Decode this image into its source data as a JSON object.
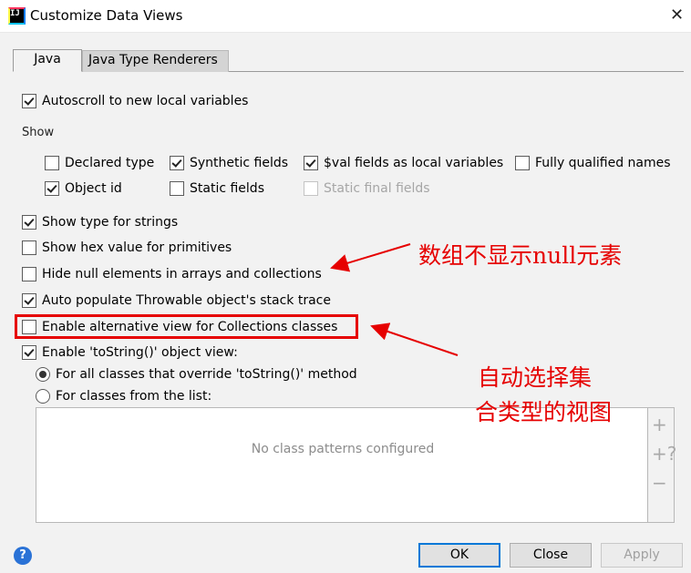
{
  "window": {
    "title": "Customize Data Views",
    "app_icon_text": "IJ"
  },
  "tabs": [
    {
      "label": "Java"
    },
    {
      "label": "Java Type Renderers"
    }
  ],
  "autoscroll": {
    "label": "Autoscroll to new local variables",
    "checked": true
  },
  "show_section": {
    "label": "Show",
    "row1": [
      {
        "label": "Declared type",
        "checked": false
      },
      {
        "label": "Synthetic fields",
        "checked": true
      },
      {
        "label": "$val fields as local variables",
        "checked": true
      },
      {
        "label": "Fully qualified names",
        "checked": false
      }
    ],
    "row2": [
      {
        "label": "Object id",
        "checked": true
      },
      {
        "label": "Static fields",
        "checked": false
      },
      {
        "label": "Static final fields",
        "checked": false,
        "disabled": true
      }
    ]
  },
  "options": [
    {
      "label": "Show type for strings",
      "checked": true
    },
    {
      "label": "Show hex value for primitives",
      "checked": false
    },
    {
      "label": "Hide null elements in arrays and collections",
      "checked": false
    },
    {
      "label": "Auto populate Throwable object's stack trace",
      "checked": true
    },
    {
      "label": "Enable alternative view for Collections classes",
      "checked": false
    },
    {
      "label": "Enable 'toString()' object view:",
      "checked": true
    }
  ],
  "tostring_radios": [
    {
      "label": "For all classes that override 'toString()' method",
      "selected": true
    },
    {
      "label": "For classes from the list:",
      "selected": false
    }
  ],
  "class_list": {
    "empty_text": "No class patterns configured"
  },
  "side_tools": {
    "add": "+",
    "add_query": "+?",
    "remove": "−"
  },
  "annotations": {
    "null_note": "数组不显示null元素",
    "collections_note_line1": "自动选择集",
    "collections_note_line2": "合类型的视图"
  },
  "buttons": {
    "help": "?",
    "ok": "OK",
    "close": "Close",
    "apply": "Apply"
  },
  "colors": {
    "annotation": "#e60000",
    "ok_border": "#0078d7",
    "help": "#2a72d6"
  }
}
